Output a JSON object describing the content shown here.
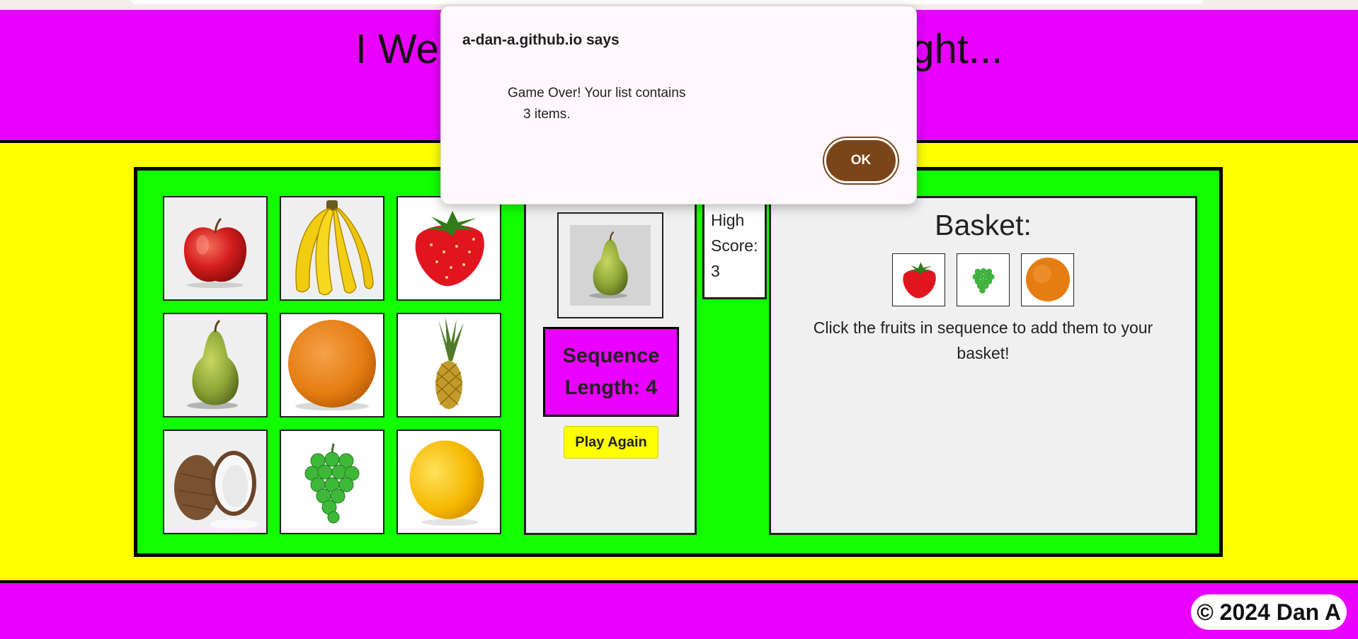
{
  "page": {
    "title": "I Went to the Market and I Bought..."
  },
  "banner": {
    "title": "I Went to the Market and I Bought..."
  },
  "grid": {
    "fruits": [
      "apple",
      "banana",
      "strawberry",
      "pear",
      "orange",
      "pineapple",
      "coconut",
      "grapes",
      "lemon"
    ]
  },
  "sequence": {
    "preview_fruit": "pear",
    "length_line1": "Sequence",
    "length_line2": "Length: 4",
    "play_again_label": "Play Again"
  },
  "high_score": {
    "line1": "High",
    "line2": "Score:",
    "value": "3"
  },
  "basket": {
    "title": "Basket:",
    "items": [
      "strawberry",
      "grapes",
      "orange"
    ],
    "instructions": "Click the fruits in sequence to add them to your basket!"
  },
  "footer": {
    "copyright": "© 2024 Dan A"
  },
  "dialog": {
    "title": "a-dan-a.github.io says",
    "message_line1": "Game Over! Your list contains",
    "message_line2": "3 items.",
    "ok_label": "OK"
  },
  "colors": {
    "banner": "#ea00ff",
    "background": "#ffff00",
    "stage": "#11ff00",
    "panel": "#f0f0f0",
    "button": "#ffff00",
    "dialog_ok": "#7a4518"
  }
}
